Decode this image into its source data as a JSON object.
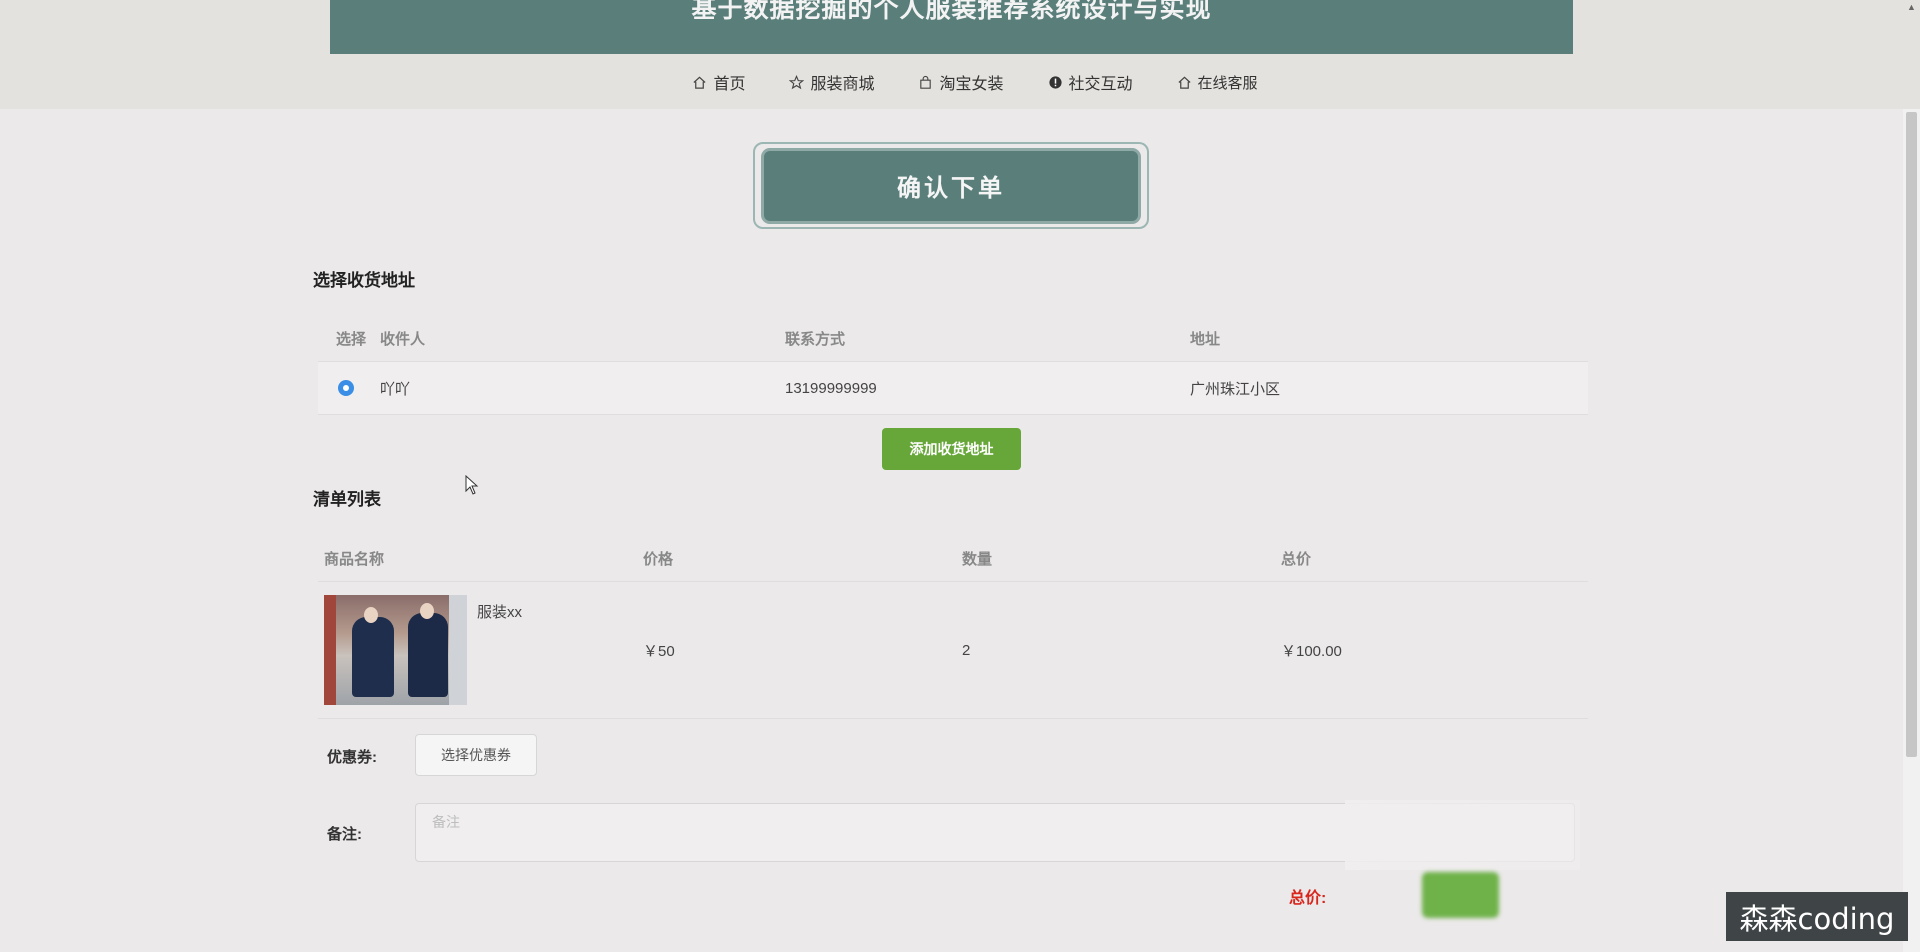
{
  "header": {
    "title": "基于数据挖掘的个人服装推荐系统设计与实现",
    "nav": [
      {
        "label": "首页",
        "icon": "home-icon"
      },
      {
        "label": "服装商城",
        "icon": "star-icon"
      },
      {
        "label": "淘宝女装",
        "icon": "bag-icon"
      },
      {
        "label": "社交互动",
        "icon": "info-icon"
      },
      {
        "label": "在线客服",
        "icon": "home-icon"
      }
    ]
  },
  "page": {
    "title": "确认下单"
  },
  "address": {
    "section_title": "选择收货地址",
    "columns": [
      "选择",
      "收件人",
      "联系方式",
      "地址"
    ],
    "rows": [
      {
        "name": "吖吖",
        "phone": "13199999999",
        "addr": "广州珠江小区",
        "selected": true
      }
    ],
    "add_button": "添加收货地址"
  },
  "items": {
    "section_title": "清单列表",
    "columns": [
      "商品名称",
      "价格",
      "数量",
      "总价"
    ],
    "rows": [
      {
        "name": "服装xx",
        "price": "￥50",
        "qty": "2",
        "total": "￥100.00"
      }
    ]
  },
  "coupon": {
    "label": "优惠券:",
    "button": "选择优惠券"
  },
  "remark": {
    "label": "备注:",
    "placeholder": "备注"
  },
  "summary": {
    "total_label": "总价:"
  },
  "watermark": "森森coding",
  "colors": {
    "header_green": "#5a7f7b",
    "add_button_green": "#67a73a",
    "total_red": "#d9261c",
    "radio_blue": "#3a8ee6"
  }
}
